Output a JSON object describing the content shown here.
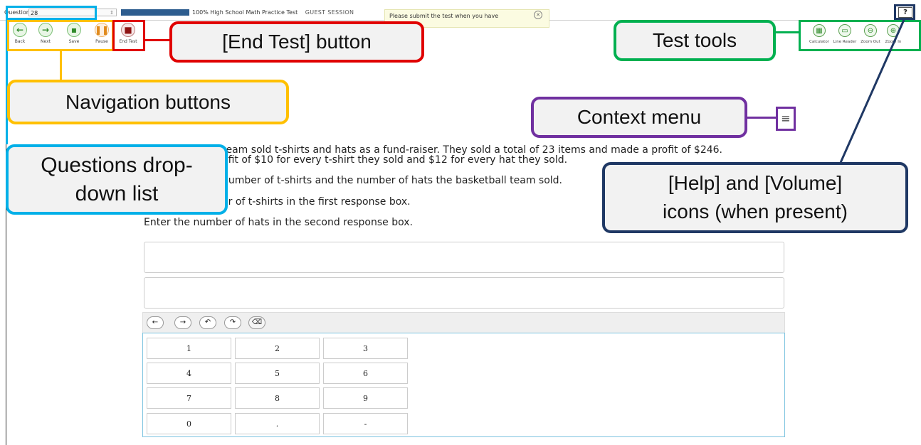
{
  "topbar": {
    "questions_label": "Questions:",
    "question_number": "28",
    "progress_text": "100%  High School Math Practice Test",
    "session_text": "GUEST SESSION",
    "notice_text": "Please submit the test when you have",
    "help_icon": "?"
  },
  "nav": {
    "back": "Back",
    "next": "Next",
    "save": "Save",
    "pause": "Pause",
    "end_test": "End Test"
  },
  "tools": {
    "calculator": "Calculator",
    "line_reader": "Line Reader",
    "zoom_out": "Zoom Out",
    "zoom_in": "Zoom In"
  },
  "question": {
    "line1_a": "team sold t-shirts and hats as a fund-raiser. They sold a total of 23 items and made a profit of $246.",
    "line1_b": "ofit of $10 for every t-shirt they sold and $12 for every hat they sold.",
    "line2": "number of t-shirts and the number of hats the basketball team sold.",
    "line3": "er of t-shirts in the first response box.",
    "line4": "Enter the number of hats in the second response box."
  },
  "keypad": {
    "keys": [
      "1",
      "2",
      "3",
      "4",
      "5",
      "6",
      "7",
      "8",
      "9",
      "0",
      ".",
      "-"
    ]
  },
  "callouts": {
    "end_test": "[End Test] button",
    "test_tools": "Test tools",
    "navigation": "Navigation buttons",
    "context_menu": "Context menu",
    "questions_dropdown_1": "Questions drop-",
    "questions_dropdown_2": "down list",
    "help_volume_1": "[Help] and [Volume]",
    "help_volume_2": "icons (when present)"
  },
  "colors": {
    "blue_callout": "#00b0e8",
    "yellow_callout": "#ffc000",
    "red_callout": "#e00000",
    "green_callout": "#00b050",
    "purple_callout": "#7030a0",
    "navy_callout": "#1f3864"
  }
}
